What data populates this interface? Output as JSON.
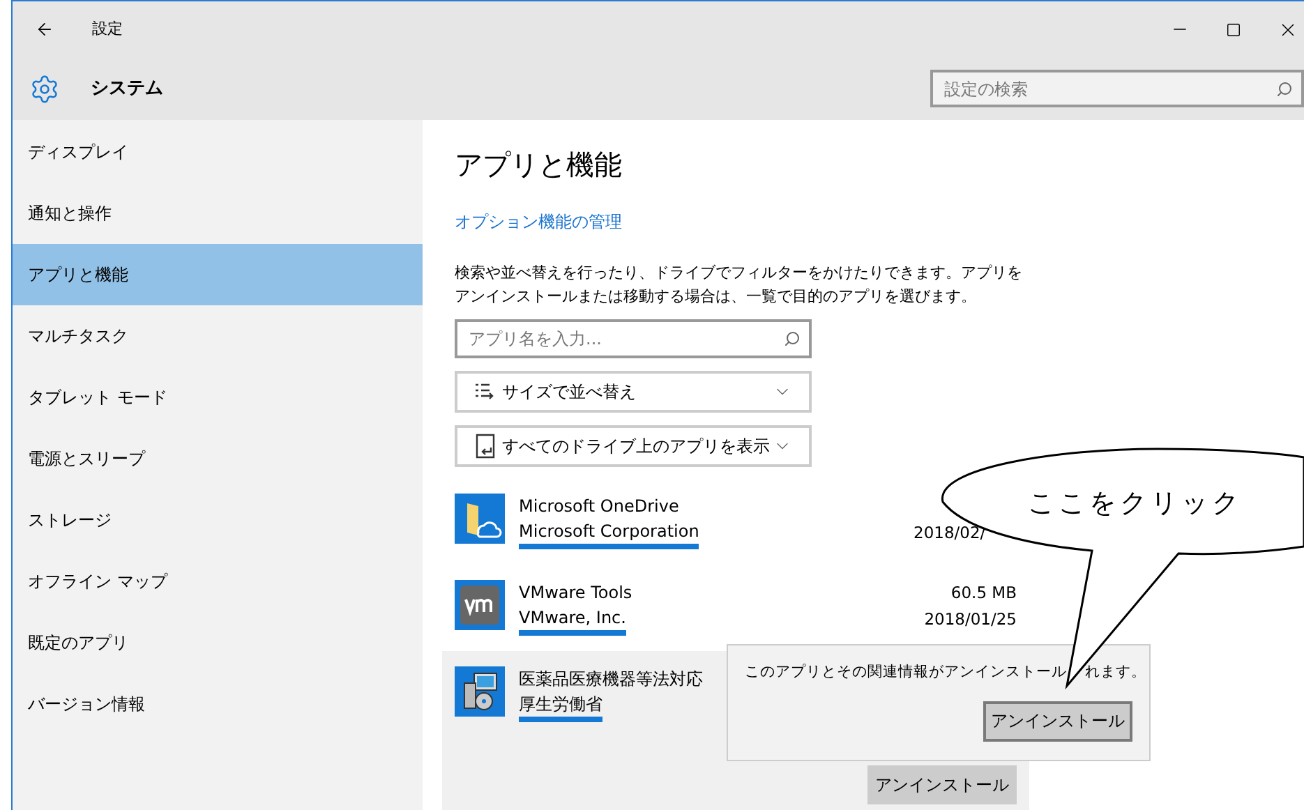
{
  "window": {
    "title": "設定"
  },
  "header": {
    "title": "システム",
    "search": {
      "placeholder": "設定の検索"
    }
  },
  "sidebar": {
    "items": [
      {
        "label": "ディスプレイ",
        "selected": false
      },
      {
        "label": "通知と操作",
        "selected": false
      },
      {
        "label": "アプリと機能",
        "selected": true
      },
      {
        "label": "マルチタスク",
        "selected": false
      },
      {
        "label": "タブレット モード",
        "selected": false
      },
      {
        "label": "電源とスリープ",
        "selected": false
      },
      {
        "label": "ストレージ",
        "selected": false
      },
      {
        "label": "オフライン マップ",
        "selected": false
      },
      {
        "label": "既定のアプリ",
        "selected": false
      },
      {
        "label": "バージョン情報",
        "selected": false
      }
    ]
  },
  "main": {
    "title": "アプリと機能",
    "link": "オプション機能の管理",
    "description": "検索や並べ替えを行ったり、ドライブでフィルターをかけたりできます。アプリをアンインストールまたは移動する場合は、一覧で目的のアプリを選びます。",
    "search": {
      "placeholder": "アプリ名を入力..."
    },
    "sort": {
      "value": "サイズで並べ替え"
    },
    "filter": {
      "value": "すべてのドライブ上のアプリを表示"
    },
    "apps": [
      {
        "kind": "onedrive",
        "name": "Microsoft OneDrive",
        "publisher": "Microsoft Corporation",
        "date": "2018/02/",
        "selected": false
      },
      {
        "kind": "vmware",
        "name": "VMware Tools",
        "publisher": "VMware, Inc.",
        "size": "60.5 MB",
        "date": "2018/01/25",
        "selected": false
      },
      {
        "kind": "installer",
        "name": "医薬品医療機器等法対応",
        "publisher": "厚生労働省",
        "selected": true,
        "button": "アンインストール"
      }
    ]
  },
  "flyout": {
    "message": "このアプリとその関連情報がアンインストール",
    "message_end": "れます。",
    "button": "アンインストール"
  },
  "callout": {
    "text": "ここをクリック"
  }
}
